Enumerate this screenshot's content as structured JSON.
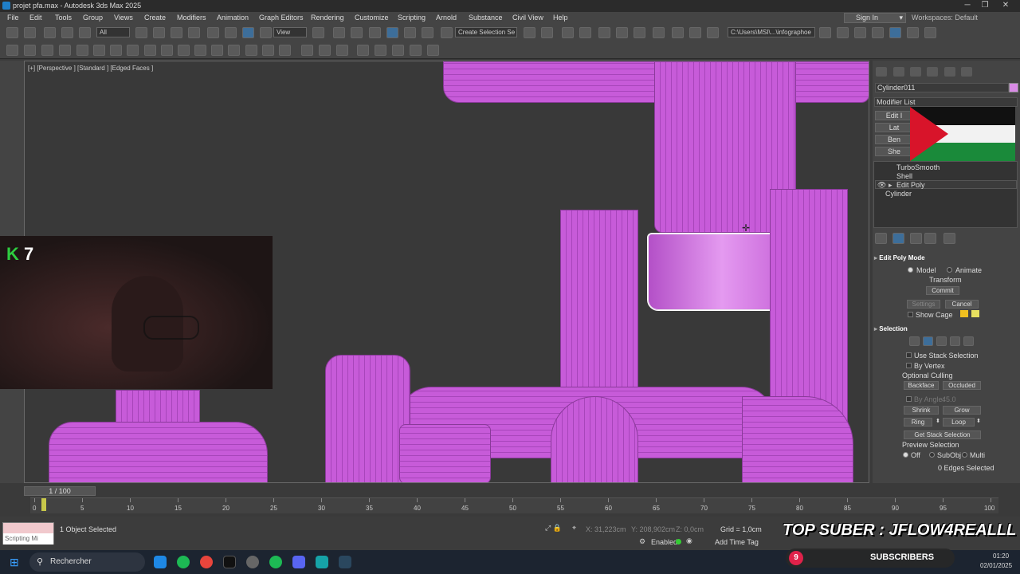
{
  "window": {
    "title": "projet pfa.max - Autodesk 3ds Max 2025",
    "controls": [
      "─",
      "❐",
      "✕"
    ]
  },
  "menu": [
    "File",
    "Edit",
    "Tools",
    "Group",
    "Views",
    "Create",
    "Modifiers",
    "Animation",
    "Graph Editors",
    "Rendering",
    "Customize",
    "Scripting",
    "Arnold",
    "Substance",
    "Civil View",
    "Help"
  ],
  "account": {
    "sign_in": "Sign In",
    "workspaces_label": "Workspaces:",
    "workspace": "Default"
  },
  "toolbar": {
    "filter": "All",
    "ref_coord": "View",
    "selection_set": "Create Selection Se",
    "project_path": "C:\\Users\\MSI\\...\\infographoe"
  },
  "viewport": {
    "label": "[+] [Perspective ] [Standard ] [Edged Faces ]"
  },
  "overlay": {
    "webcam_counter_k": "K",
    "webcam_counter_num": "7",
    "banner": "TOP SUBER : JFLOW4REALLL",
    "subscribers_count": "9",
    "subscribers_label": "SUBSCRIBERS"
  },
  "command_panel": {
    "object_name": "Cylinder011",
    "object_color": "#d98be6",
    "modifier_list": "Modifier List",
    "mod_buttons": [
      "Edit I",
      "Lat",
      "Ben",
      "She"
    ],
    "stack": [
      "TurboSmooth",
      "Shell",
      "Edit Poly",
      "Cylinder"
    ],
    "edit_poly_mode": {
      "title": "Edit Poly Mode",
      "model": "Model",
      "animate": "Animate",
      "transform": "Transform",
      "commit": "Commit",
      "settings": "Settings",
      "cancel": "Cancel",
      "show_cage": "Show Cage"
    },
    "selection": {
      "title": "Selection",
      "use_stack": "Use Stack Selection",
      "by_vertex": "By Vertex",
      "optional_culling": "Optional Culling",
      "backface": "Backface",
      "occluded": "Occluded",
      "by_angle": "By Angle:",
      "angle_value": "45.0",
      "shrink": "Shrink",
      "grow": "Grow",
      "ring": "Ring",
      "loop": "Loop",
      "get_stack": "Get Stack Selection",
      "preview": "Preview Selection",
      "off": "Off",
      "subobj": "SubObj",
      "multi": "Multi",
      "edges_selected": "0 Edges Selected"
    }
  },
  "timeline": {
    "slider": "1 / 100",
    "ticks": [
      "0",
      "5",
      "10",
      "15",
      "20",
      "25",
      "30",
      "35",
      "40",
      "45",
      "50",
      "55",
      "60",
      "65",
      "70",
      "75",
      "80",
      "85",
      "90",
      "95",
      "100"
    ]
  },
  "status": {
    "scripting": "Scripting Mi",
    "objects_selected": "1 Object Selected",
    "x": "X: 31,223cm",
    "y": "Y: 208,902cm",
    "z": "Z: 0,0cm",
    "grid": "Grid = 1,0cm",
    "enabled": "Enabled:",
    "add_time_tag": "Add Time Tag"
  },
  "taskbar": {
    "search": "Rechercher",
    "time": "01:20",
    "date": "02/01/2025"
  }
}
